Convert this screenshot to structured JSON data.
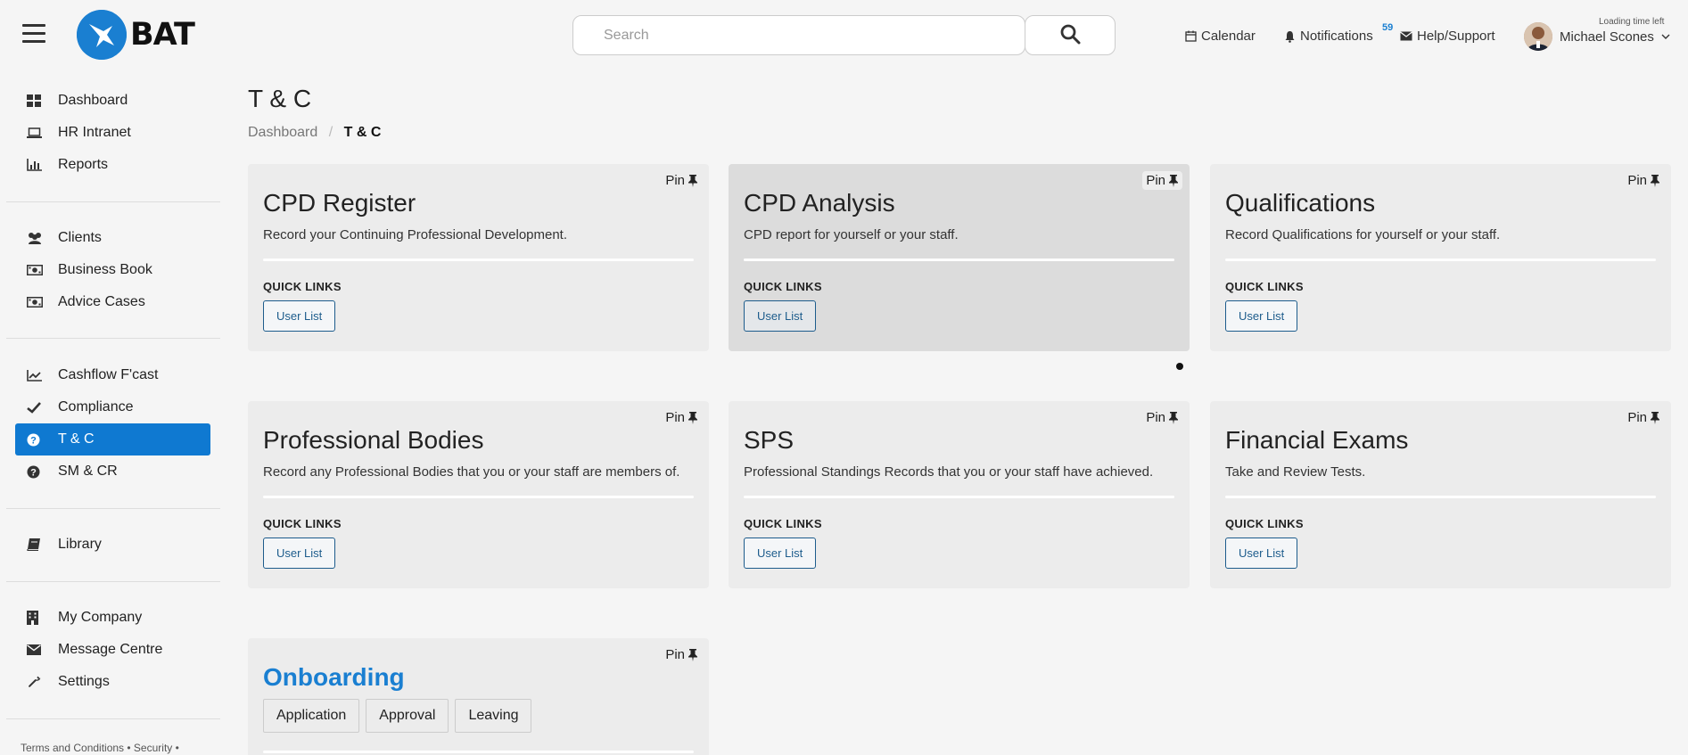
{
  "header": {
    "logo_text": "BAT",
    "search_placeholder": "Search",
    "calendar": "Calendar",
    "notifications": "Notifications",
    "notification_count": "59",
    "help": "Help/Support",
    "loading_text": "Loading time left",
    "user_name": "Michael Scones"
  },
  "sidebar": {
    "items": [
      {
        "label": "Dashboard",
        "icon": "dashboard-icon"
      },
      {
        "label": "HR Intranet",
        "icon": "laptop-icon"
      },
      {
        "label": "Reports",
        "icon": "bar-chart-icon"
      },
      {
        "label": "Clients",
        "icon": "users-icon"
      },
      {
        "label": "Business Book",
        "icon": "money-icon"
      },
      {
        "label": "Advice Cases",
        "icon": "money-icon"
      },
      {
        "label": "Cashflow F'cast",
        "icon": "line-chart-icon"
      },
      {
        "label": "Compliance",
        "icon": "check-icon"
      },
      {
        "label": "T & C",
        "icon": "question-circle-icon"
      },
      {
        "label": "SM & CR",
        "icon": "question-circle-icon"
      },
      {
        "label": "Library",
        "icon": "book-icon"
      },
      {
        "label": "My Company",
        "icon": "building-icon"
      },
      {
        "label": "Message Centre",
        "icon": "envelope-icon"
      },
      {
        "label": "Settings",
        "icon": "wrench-icon"
      }
    ],
    "footer": "Terms and Conditions • Security •"
  },
  "main": {
    "title": "T & C",
    "breadcrumb": {
      "parent": "Dashboard",
      "sep": "/",
      "current": "T & C"
    },
    "pin_label": "Pin",
    "quick_links_label": "QUICK LINKS",
    "user_list_label": "User List",
    "cards": [
      {
        "title": "CPD Register",
        "desc": "Record your Continuing Professional Development."
      },
      {
        "title": "CPD Analysis",
        "desc": "CPD report for yourself or your staff."
      },
      {
        "title": "Qualifications",
        "desc": "Record Qualifications for yourself or your staff."
      },
      {
        "title": "Professional Bodies",
        "desc": "Record any Professional Bodies that you or your staff are members of."
      },
      {
        "title": "SPS",
        "desc": "Professional Standings Records that you or your staff have achieved."
      },
      {
        "title": "Financial Exams",
        "desc": "Take and Review Tests."
      }
    ],
    "onboarding": {
      "title": "Onboarding",
      "tabs": [
        "Application",
        "Approval",
        "Leaving"
      ]
    }
  },
  "colors": {
    "accent": "#0f79d1",
    "link": "#1a7fd1",
    "button_border": "#1d5c8c"
  }
}
